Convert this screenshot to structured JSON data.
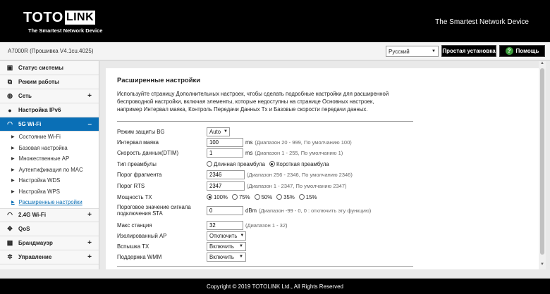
{
  "header": {
    "logo_part1": "TOTO",
    "logo_part2": "LINK",
    "logo_tagline": "The Smartest Network Device",
    "slogan": "The Smartest Network Device"
  },
  "topbar": {
    "model": "A7000R (Прошивка V4.1cu.4025)",
    "language": "Русский",
    "wizard_label": "Простая установка",
    "help_label": "Помощь"
  },
  "sidebar": {
    "items": [
      {
        "label": "Статус системы",
        "icon": "monitor-icon"
      },
      {
        "label": "Режим работы",
        "icon": "mode-icon"
      },
      {
        "label": "Сеть",
        "icon": "globe-icon",
        "expand": "+"
      },
      {
        "label": "Настройка IPv6",
        "icon": "ipv6-icon"
      },
      {
        "label": "5G Wi-Fi",
        "icon": "wifi-icon",
        "expand": "–"
      },
      {
        "label": "2.4G Wi-Fi",
        "icon": "wifi-icon",
        "expand": "+"
      },
      {
        "label": "QoS",
        "icon": "qos-icon"
      },
      {
        "label": "Брандмауэр",
        "icon": "lock-icon",
        "expand": "+"
      },
      {
        "label": "Управление",
        "icon": "gear-icon",
        "expand": "+"
      }
    ],
    "sub_items": [
      "Состояние Wi-Fi",
      "Базовая настройка",
      "Множественные AP",
      "Аутентификация по MAC",
      "Настройка WDS",
      "Настройка WPS",
      "Расширенные настройки"
    ]
  },
  "main": {
    "title": "Расширенные настройки",
    "description": "Используйте страницу Дополнительных настроек, чтобы сделать подробные настройки для расширенной беспроводной настройки, включая элементы, которые недоступны на странице Основных настроек, например Интервал маяка, Контроль Передачи Данных Tx и Базовые скорости передачи данных.",
    "fields": {
      "bg_protection": {
        "label": "Режим защиты BG",
        "value": "Auto"
      },
      "beacon": {
        "label": "Интервал маяка",
        "value": "100",
        "unit": "ms",
        "hint": "(Диапазон 20 - 999, По умолчанию 100)"
      },
      "dtim": {
        "label": "Скорость данных(DTIM)",
        "value": "1",
        "unit": "ms",
        "hint": "(Диапазон 1 - 255, По умолчанию 1)"
      },
      "preamble": {
        "label": "Тип преамбулы",
        "opt_long": "Длинная преамбула",
        "opt_short": "Короткая преамбула"
      },
      "fragment": {
        "label": "Порог фрагмента",
        "value": "2346",
        "hint": "(Диапазон 256 - 2346, По умолчанию 2346)"
      },
      "rts": {
        "label": "Порог RTS",
        "value": "2347",
        "hint": "(Диапазон 1 - 2347, По умолчанию 2347)"
      },
      "tx_power": {
        "label": "Мощность TX",
        "options": [
          "100%",
          "75%",
          "50%",
          "35%",
          "15%"
        ]
      },
      "sta_threshold": {
        "label": "Пороговое значение сигнала подключения STA",
        "value": "0",
        "unit": "dBm",
        "hint": "(Диапазон -99 - 0, 0 : отключить эту функцию)"
      },
      "max_sta": {
        "label": "Макс станция",
        "value": "32",
        "hint": "(Диапазон 1 - 32)"
      },
      "isolated_ap": {
        "label": "Изолированный AP",
        "value": "Отключить"
      },
      "tx_burst": {
        "label": "Вспышка TX",
        "value": "Включить"
      },
      "wmm": {
        "label": "Поддержка WMM",
        "value": "Включить"
      }
    }
  },
  "footer": {
    "copyright": "Copyright © 2019 TOTOLINK Ltd., All Rights Reserved"
  }
}
